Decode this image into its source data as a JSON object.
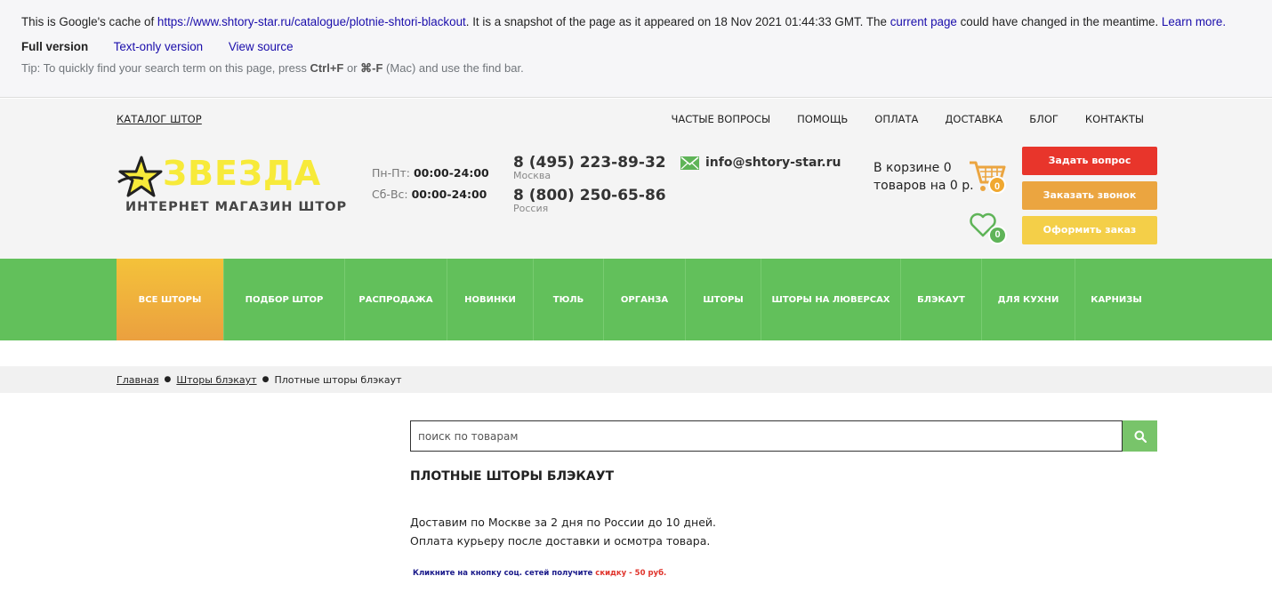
{
  "cache": {
    "prefix": "This is Google's cache of ",
    "url": "https://www.shtory-star.ru/catalogue/plotnie-shtori-blackout",
    "middle": ". It is a snapshot of the page as it appeared on 18 Nov 2021 01:44:33 GMT. The ",
    "current_page": "current page",
    "suffix": " could have changed in the meantime. ",
    "learn_more": "Learn more.",
    "full_version": "Full version",
    "text_only": "Text-only version",
    "view_source": "View source",
    "tip_prefix": "Tip: To quickly find your search term on this page, press ",
    "tip_key1": "Ctrl+F",
    "tip_or": " or ",
    "tip_key2": "⌘-F",
    "tip_suffix": " (Mac) and use the find bar."
  },
  "header": {
    "catalog_link": "КАТАЛОГ ШТОР",
    "top_nav": [
      "ЧАСТЫЕ ВОПРОСЫ",
      "ПОМОЩЬ",
      "ОПЛАТА",
      "ДОСТАВКА",
      "БЛОГ",
      "КОНТАКТЫ"
    ],
    "logo_word": "ЗВЕЗДА",
    "logo_sub": "ИНТЕРНЕТ МАГАЗИН ШТОР",
    "hours": [
      {
        "days": "Пн-Пт: ",
        "time": "00:00-24:00"
      },
      {
        "days": "Сб-Вс: ",
        "time": "00:00-24:00"
      }
    ],
    "phones": [
      {
        "number": "8 (495) 223-89-32",
        "city": "Москва"
      },
      {
        "number": "8 (800) 250-65-86",
        "city": "Россия"
      }
    ],
    "email": "info@shtory-star.ru",
    "cart_line1": "В корзине 0",
    "cart_line2": "товаров на 0 р.",
    "cart_count": "0",
    "fav_count": "0",
    "btn_ask": "Задать вопрос",
    "btn_call": "Заказать звонок",
    "btn_order": "Оформить заказ",
    "colors": {
      "ask": "#e8352b",
      "call": "#eba540",
      "order": "#f4cf48",
      "nav": "#62c05b"
    }
  },
  "main_nav": [
    {
      "label": "ВСЕ ШТОРЫ",
      "active": true
    },
    {
      "label": "ПОДБОР ШТОР"
    },
    {
      "label": "РАСПРОДАЖА"
    },
    {
      "label": "НОВИНКИ"
    },
    {
      "label": "ТЮЛЬ"
    },
    {
      "label": "ОРГАНЗА"
    },
    {
      "label": "ШТОРЫ"
    },
    {
      "label": "ШТОРЫ НА ЛЮВЕРСАХ"
    },
    {
      "label": "БЛЭКАУТ"
    },
    {
      "label": "ДЛЯ КУХНИ"
    },
    {
      "label": "КАРНИЗЫ"
    }
  ],
  "breadcrumb": {
    "home": "Главная",
    "section": "Шторы блэкаут",
    "current": "Плотные шторы блэкаут"
  },
  "search": {
    "placeholder": "поиск по товарам",
    "icon": "search-icon"
  },
  "content": {
    "title": "ПЛОТНЫЕ ШТОРЫ БЛЭКАУТ",
    "delivery_line1": "Доставим по Москве за 2 дня по России до 10 дней.",
    "delivery_line2": "Оплата курьеру после доставки и осмотра товара.",
    "promo_text": "Кликните на кнопку соц. сетей получите ",
    "promo_red": "скидку - 50 руб."
  }
}
